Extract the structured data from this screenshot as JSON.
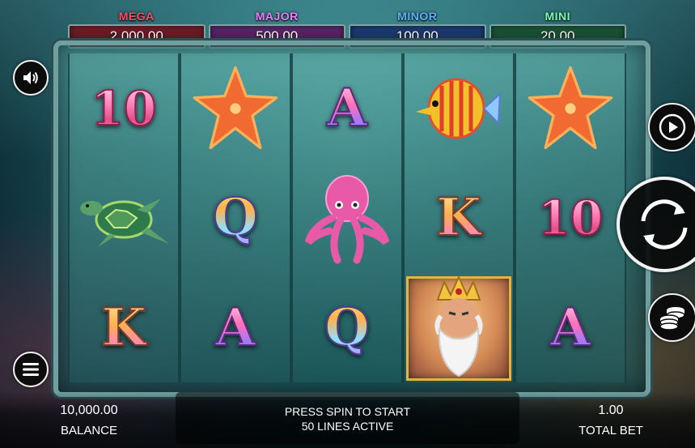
{
  "jackpots": {
    "mega": {
      "label": "MEGA",
      "value": "2,000.00"
    },
    "major": {
      "label": "MAJOR",
      "value": "500.00"
    },
    "minor": {
      "label": "MINOR",
      "value": "100.00"
    },
    "mini": {
      "label": "MINI",
      "value": "20.00"
    }
  },
  "reels": [
    [
      "10",
      "turtle",
      "K"
    ],
    [
      "starfish",
      "Q",
      "A"
    ],
    [
      "A",
      "octopus",
      "Q"
    ],
    [
      "fish",
      "K",
      "poseidon-wild"
    ],
    [
      "starfish",
      "10",
      "A"
    ]
  ],
  "symbols_text": {
    "r1c1": "10",
    "r1c3": "K",
    "r2c2": "Q",
    "r2c3": "A",
    "r3c1": "A",
    "r3c3": "Q",
    "r4c2": "K",
    "r5c2": "10",
    "r5c3": "A"
  },
  "footer": {
    "balance_value": "10,000.00",
    "balance_label": "BALANCE",
    "message_line1": "PRESS SPIN TO START",
    "message_line2": "50 LINES ACTIVE",
    "bet_value": "1.00",
    "bet_label": "TOTAL BET"
  },
  "icons": {
    "sound": "speaker-icon",
    "menu": "hamburger-menu-icon",
    "autoplay": "play-icon",
    "spin": "spin-arrows-icon",
    "bet": "coins-stack-icon"
  }
}
